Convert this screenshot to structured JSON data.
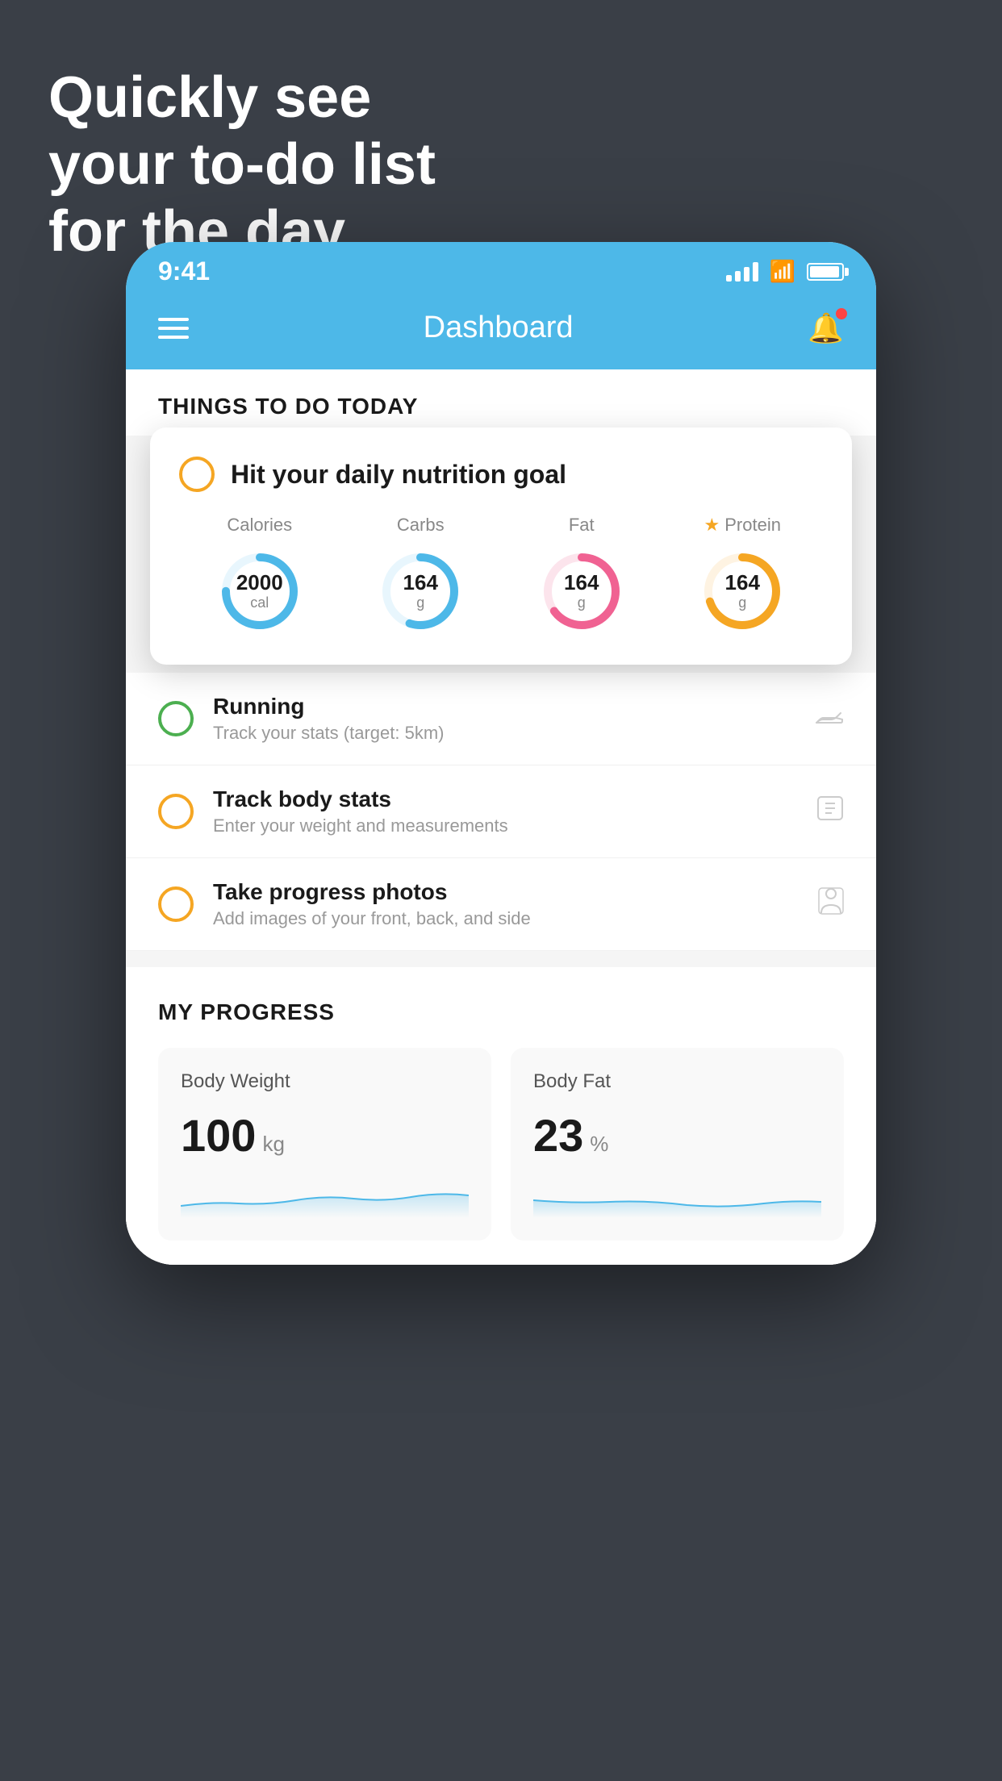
{
  "headline": {
    "line1": "Quickly see",
    "line2": "your to-do list",
    "line3": "for the day."
  },
  "status_bar": {
    "time": "9:41"
  },
  "nav": {
    "title": "Dashboard"
  },
  "things_section": {
    "title": "THINGS TO DO TODAY"
  },
  "nutrition_card": {
    "title": "Hit your daily nutrition goal",
    "stats": [
      {
        "label": "Calories",
        "value": "2000",
        "unit": "cal",
        "color": "#4db8e8",
        "track": 75
      },
      {
        "label": "Carbs",
        "value": "164",
        "unit": "g",
        "color": "#4db8e8",
        "track": 55
      },
      {
        "label": "Fat",
        "value": "164",
        "unit": "g",
        "color": "#f06292",
        "track": 65
      },
      {
        "label": "Protein",
        "value": "164",
        "unit": "g",
        "color": "#f5a623",
        "track": 70,
        "starred": true
      }
    ]
  },
  "todo_items": [
    {
      "title": "Running",
      "subtitle": "Track your stats (target: 5km)",
      "circle_color": "green",
      "icon": "shoe"
    },
    {
      "title": "Track body stats",
      "subtitle": "Enter your weight and measurements",
      "circle_color": "yellow",
      "icon": "scale"
    },
    {
      "title": "Take progress photos",
      "subtitle": "Add images of your front, back, and side",
      "circle_color": "yellow",
      "icon": "person"
    }
  ],
  "progress_section": {
    "title": "MY PROGRESS",
    "cards": [
      {
        "title": "Body Weight",
        "value": "100",
        "unit": "kg"
      },
      {
        "title": "Body Fat",
        "value": "23",
        "unit": "%"
      }
    ]
  }
}
